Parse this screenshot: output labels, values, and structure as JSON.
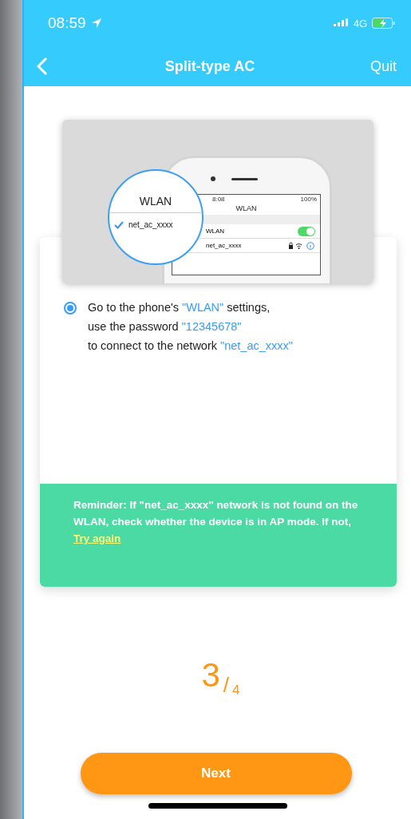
{
  "status_bar": {
    "time": "08:59",
    "network": "4G"
  },
  "nav": {
    "title": "Split-type AC",
    "action": "Quit"
  },
  "illustration": {
    "magnifier": {
      "title": "WLAN",
      "network": "net_ac_xxxx"
    },
    "phone": {
      "time": "8:08",
      "battery": "100%",
      "title": "WLAN",
      "wlan_label": "WLAN",
      "wlan_on": true,
      "network": "net_ac_xxxx"
    }
  },
  "instruction": {
    "selected": true,
    "lines": [
      [
        {
          "text": "Go to the phone's ",
          "highlight": false
        },
        {
          "text": "\"WLAN\"",
          "highlight": true
        },
        {
          "text": " settings,",
          "highlight": false
        }
      ],
      [
        {
          "text": "use the password ",
          "highlight": false
        },
        {
          "text": "\"12345678\"",
          "highlight": true
        }
      ],
      [
        {
          "text": "to connect to the network ",
          "highlight": false
        },
        {
          "text": "\"net_ac_xxxx\"",
          "highlight": true
        }
      ]
    ]
  },
  "reminder": {
    "text": "Reminder: If \"net_ac_xxxx\" network is not found on the WLAN, check whether the device is in AP mode. If not, ",
    "link": "Try again"
  },
  "step": {
    "current": "3",
    "separator": "/",
    "total": "4"
  },
  "button": "Next"
}
